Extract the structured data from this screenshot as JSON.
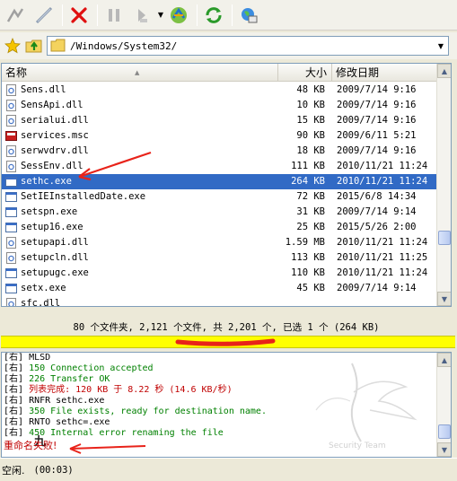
{
  "toolbar": {
    "buttons": [
      "connect-icon",
      "disconnect-icon",
      "abort-icon",
      "pause-icon",
      "skip-icon",
      "transfer-icon",
      "refresh-icon",
      "world-icon"
    ]
  },
  "address": {
    "path": "/Windows/System32/"
  },
  "filelist": {
    "columns": {
      "name": "名称",
      "size": "大小",
      "modified": "修改日期"
    },
    "rows": [
      {
        "name": "Sens.dll",
        "size": "48 KB",
        "date": "2009/7/14 9:16",
        "icon": "dll-icon"
      },
      {
        "name": "SensApi.dll",
        "size": "10 KB",
        "date": "2009/7/14 9:16",
        "icon": "dll-icon"
      },
      {
        "name": "serialui.dll",
        "size": "15 KB",
        "date": "2009/7/14 9:16",
        "icon": "dll-icon"
      },
      {
        "name": "services.msc",
        "size": "90 KB",
        "date": "2009/6/11 5:21",
        "icon": "msc-icon"
      },
      {
        "name": "serwvdrv.dll",
        "size": "18 KB",
        "date": "2009/7/14 9:16",
        "icon": "dll-icon"
      },
      {
        "name": "SessEnv.dll",
        "size": "111 KB",
        "date": "2010/11/21 11:24",
        "icon": "dll-icon"
      },
      {
        "name": "sethc.exe",
        "size": "264 KB",
        "date": "2010/11/21 11:24",
        "icon": "exe-icon",
        "selected": true
      },
      {
        "name": "SetIEInstalledDate.exe",
        "size": "72 KB",
        "date": "2015/6/8 14:34",
        "icon": "exe-icon"
      },
      {
        "name": "setspn.exe",
        "size": "31 KB",
        "date": "2009/7/14 9:14",
        "icon": "exe-icon"
      },
      {
        "name": "setup16.exe",
        "size": "25 KB",
        "date": "2015/5/26 2:00",
        "icon": "exe-icon"
      },
      {
        "name": "setupapi.dll",
        "size": "1.59 MB",
        "date": "2010/11/21 11:24",
        "icon": "dll-icon"
      },
      {
        "name": "setupcln.dll",
        "size": "113 KB",
        "date": "2010/11/21 11:25",
        "icon": "dll-icon"
      },
      {
        "name": "setupugc.exe",
        "size": "110 KB",
        "date": "2010/11/21 11:24",
        "icon": "exe-icon"
      },
      {
        "name": "setx.exe",
        "size": "45 KB",
        "date": "2009/7/14 9:14",
        "icon": "exe-icon"
      },
      {
        "name": "sfc.dll",
        "size": "",
        "date": "",
        "icon": "dll-icon",
        "partial": true
      }
    ]
  },
  "status": {
    "summary": "80 个文件夹, 2,121 个文件, 共 2,201 个, 已选 1 个 (264 KB)"
  },
  "log": {
    "lines": [
      {
        "prefix": "[右]",
        "text": "MLSD",
        "color": "#000000"
      },
      {
        "prefix": "[右]",
        "text": "150 Connection accepted",
        "color": "#008000"
      },
      {
        "prefix": "[右]",
        "text": "226 Transfer OK",
        "color": "#008000"
      },
      {
        "prefix": "[右]",
        "text": "列表完成: 120 KB 于 8.22 秒 (14.6 KB/秒)",
        "color": "#c00000"
      },
      {
        "prefix": "[右]",
        "text": "RNFR sethc.exe",
        "color": "#000000"
      },
      {
        "prefix": "[右]",
        "text": "350 File exists, ready for destination name.",
        "color": "#008000"
      },
      {
        "prefix": "[右]",
        "text": "RNTO sethc=.exe",
        "color": "#000000"
      },
      {
        "prefix": "[右]",
        "text": "450 Internal error renaming the file",
        "color": "#008000"
      }
    ],
    "final": "重命名失败!",
    "final_color": "#c00000",
    "watermark_glyph": "九",
    "watermark_text": "Security Team"
  },
  "bottom": {
    "state": "空闲.",
    "time": "(00:03)"
  },
  "colors": {
    "selection": "#316ac5",
    "highlight": "#ffff00",
    "annotation": "#e8231a",
    "log_green": "#008000",
    "log_red": "#c00000"
  }
}
